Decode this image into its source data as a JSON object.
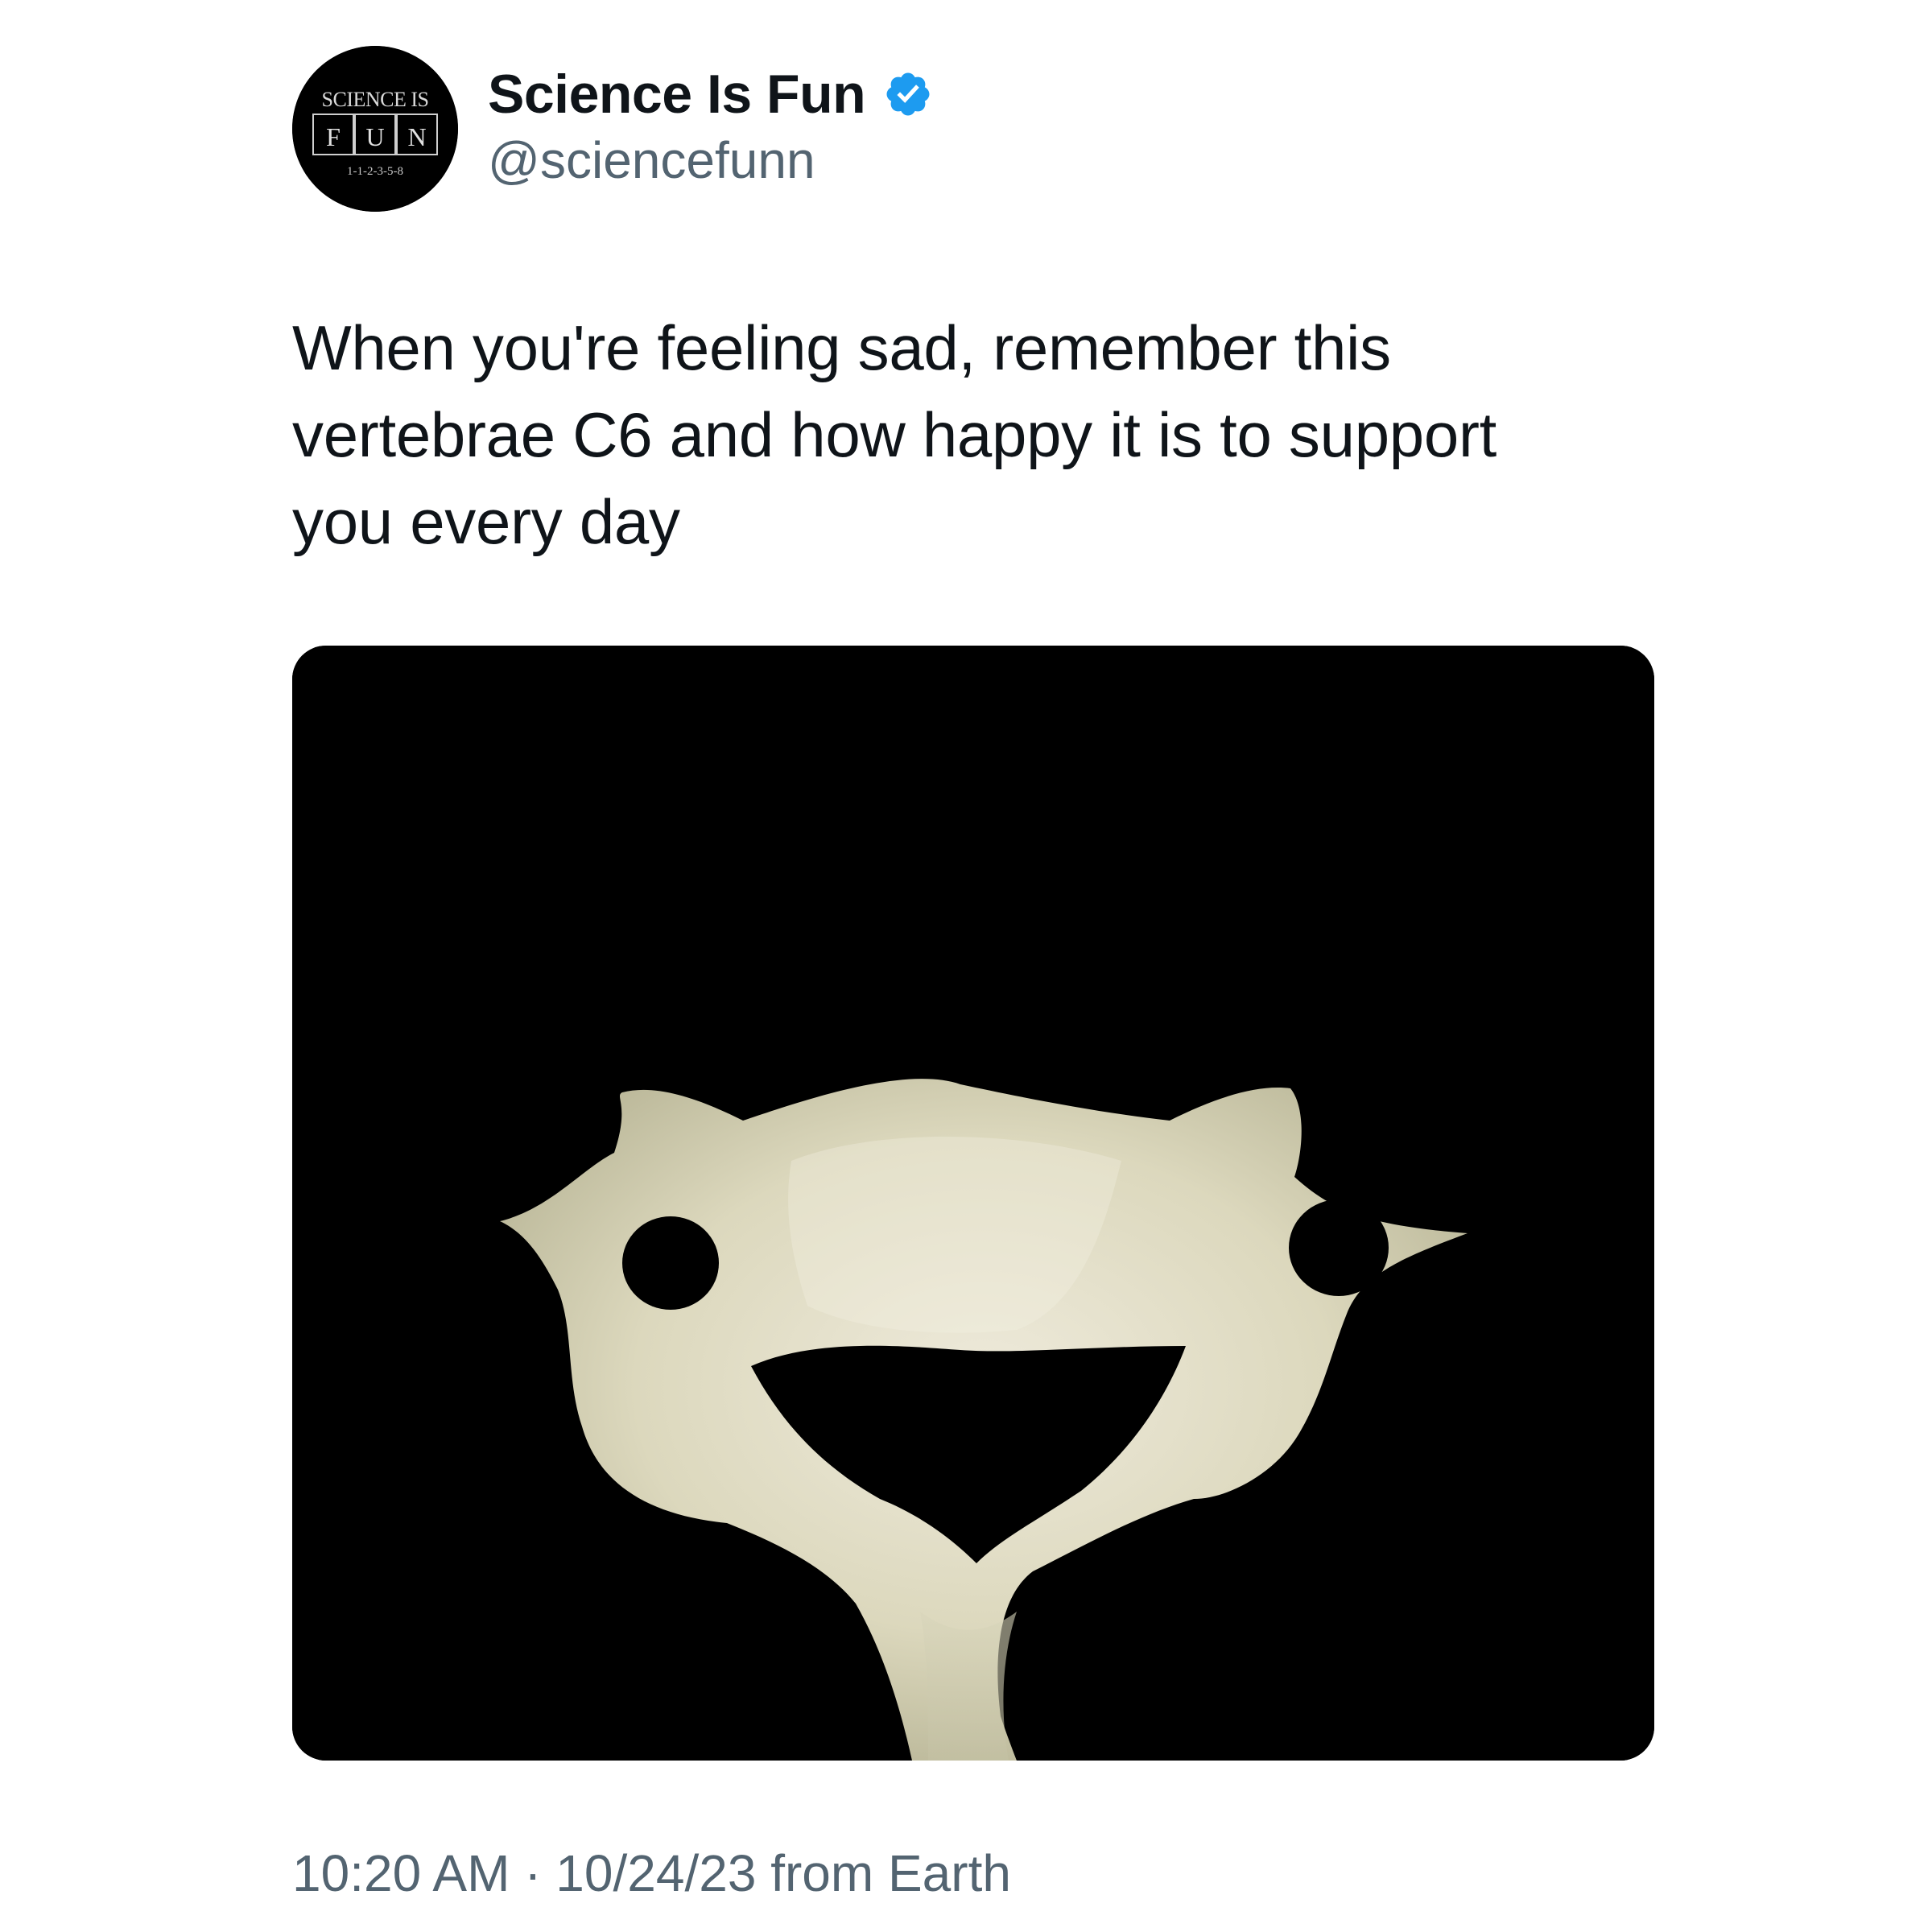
{
  "tweet": {
    "author": {
      "display_name": "Science Is Fun",
      "handle": "@sciencefunn",
      "verified": true,
      "verified_icon": "verified-badge-icon",
      "verified_color": "#1d9bf0",
      "avatar": {
        "logo_text_top": "SCIENCE IS",
        "logo_letters": [
          "F",
          "U",
          "N"
        ],
        "logo_text_bottom": "1-1-2-3-5-8"
      }
    },
    "text": "When you're feeling sad, remember this\nvertebrae C6 and how happy it is to support\nyou every day",
    "media": {
      "type": "photo",
      "subject": "vertebra-image",
      "background": "#000000",
      "bone_color": "#e6e2c8"
    },
    "timestamp": {
      "time": "10:20 AM",
      "separator": " · ",
      "date": "10/24/23",
      "source": " from Earth"
    }
  }
}
